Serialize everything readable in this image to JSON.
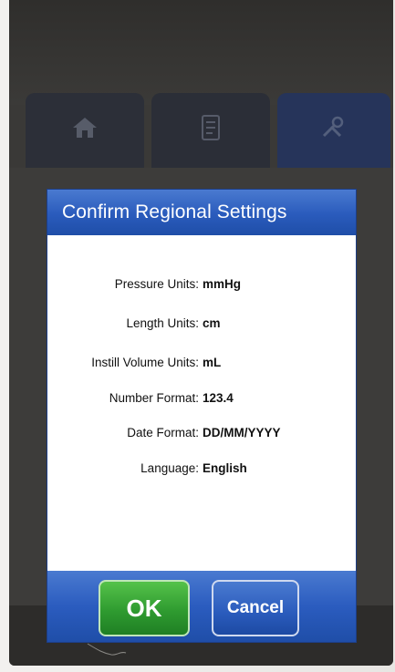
{
  "dialog": {
    "title": "Confirm Regional Settings",
    "rows": [
      {
        "label": "Pressure Units:",
        "value": "mmHg"
      },
      {
        "label": "Length Units:",
        "value": "cm"
      },
      {
        "label": "Instill Volume Units:",
        "value": "mL"
      },
      {
        "label": "Number Format:",
        "value": "123.4"
      },
      {
        "label": "Date Format:",
        "value": "DD/MM/YYYY"
      },
      {
        "label": "Language:",
        "value": "English"
      }
    ],
    "ok_label": "OK",
    "cancel_label": "Cancel"
  },
  "tabs": [
    {
      "icon": "home-icon"
    },
    {
      "icon": "document-icon"
    },
    {
      "icon": "tools-icon"
    }
  ],
  "colors": {
    "header_blue": "#2a5bbc",
    "ok_green": "#2f9b30",
    "device_dark": "#3a3937"
  }
}
